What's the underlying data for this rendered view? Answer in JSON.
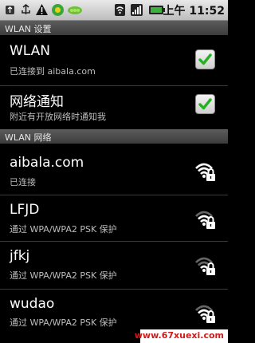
{
  "status_bar": {
    "icons": [
      "usb-icon",
      "usb-debug-icon",
      "warning-icon",
      "app-icon",
      "peas-icon",
      "wifi-status-icon",
      "signal-icon",
      "battery-icon"
    ],
    "time": "上午 11:52"
  },
  "title": "WLAN 设置",
  "settings": [
    {
      "title": "WLAN",
      "summary": "已连接到 aibala.com",
      "checked": true
    },
    {
      "title": "网络通知",
      "summary": "附近有开放网络时通知我",
      "checked": true
    }
  ],
  "section_header": "WLAN 网络",
  "networks": [
    {
      "ssid": "aibala.com",
      "status": "已连接",
      "signal": "strong",
      "secured": true
    },
    {
      "ssid": "LFJD",
      "status": "通过 WPA/WPA2 PSK 保护",
      "signal": "weak",
      "secured": true
    },
    {
      "ssid": "jfkj",
      "status": "通过 WPA/WPA2 PSK 保护",
      "signal": "weak",
      "secured": true
    },
    {
      "ssid": "wudao",
      "status": "通过 WPA/WPA2 PSK 保护",
      "signal": "weak",
      "secured": true
    }
  ],
  "watermark": "www.67xuexi.com",
  "colors": {
    "background": "#000000",
    "check": "#27b023",
    "watermark": "#d11b1b"
  }
}
